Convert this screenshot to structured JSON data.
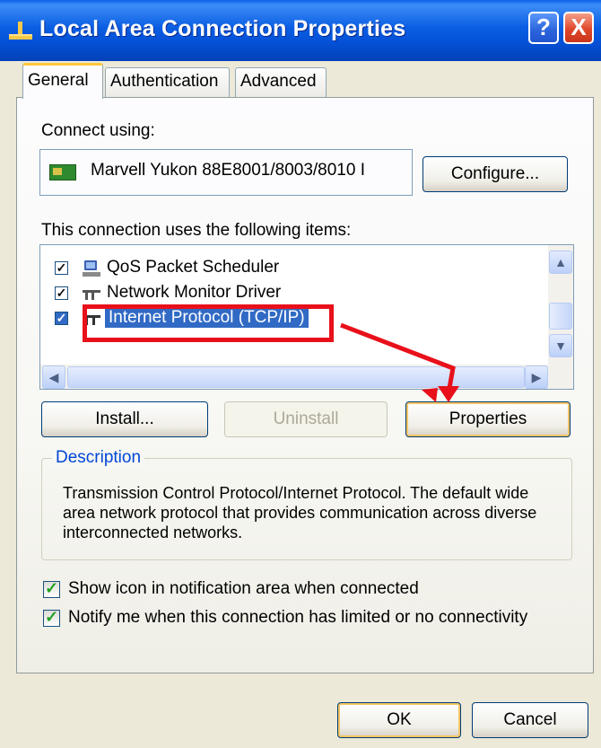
{
  "window": {
    "title": "Local Area Connection Properties",
    "help_label": "?",
    "close_label": "X"
  },
  "tabs": [
    {
      "label": "General",
      "active": true
    },
    {
      "label": "Authentication",
      "active": false
    },
    {
      "label": "Advanced",
      "active": false
    }
  ],
  "connect_using": {
    "label": "Connect using:",
    "adapter": "Marvell Yukon 88E8001/8003/8010 I",
    "configure_label": "Configure..."
  },
  "items_section": {
    "label": "This connection uses the following items:",
    "items": [
      {
        "label": "QoS Packet Scheduler",
        "checked": true,
        "selected": false,
        "icon": "qos-scheduler-icon"
      },
      {
        "label": "Network Monitor Driver",
        "checked": true,
        "selected": false,
        "icon": "network-driver-icon"
      },
      {
        "label": "Internet Protocol (TCP/IP)",
        "checked": true,
        "selected": true,
        "icon": "network-protocol-icon"
      }
    ],
    "scroll_left_label": "<",
    "scroll_right_label": ">",
    "scroll_up_label": "^",
    "scroll_down_label": "v"
  },
  "buttons": {
    "install": "Install...",
    "uninstall": "Uninstall",
    "properties": "Properties"
  },
  "description": {
    "title": "Description",
    "text": "Transmission Control Protocol/Internet Protocol. The default wide area network protocol that provides communication across diverse interconnected networks."
  },
  "options": {
    "show_icon": {
      "label": "Show icon in notification area when connected",
      "checked": true
    },
    "notify": {
      "label": "Notify me when this connection has limited or no connectivity",
      "checked": true
    }
  },
  "dialog_buttons": {
    "ok": "OK",
    "cancel": "Cancel"
  },
  "colors": {
    "titlebar": "#0450d6",
    "selection": "#316ac5",
    "annotation": "#e8101a",
    "group_title": "#0046d5"
  }
}
